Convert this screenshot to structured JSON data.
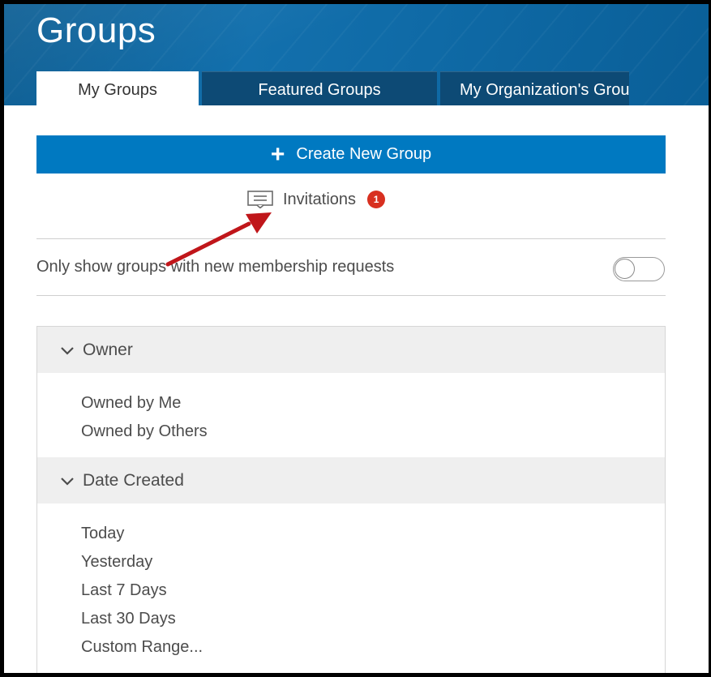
{
  "header": {
    "title": "Groups",
    "tabs": [
      {
        "label": "My Groups",
        "active": true
      },
      {
        "label": "Featured Groups",
        "active": false
      },
      {
        "label": "My Organization's Grou",
        "active": false
      }
    ]
  },
  "actions": {
    "create_label": "Create New Group",
    "invitations_label": "Invitations",
    "invitations_count": "1"
  },
  "filters": {
    "toggle_label": "Only show groups with new membership requests",
    "toggle_on": false,
    "sections": [
      {
        "title": "Owner",
        "items": [
          "Owned by Me",
          "Owned by Others"
        ]
      },
      {
        "title": "Date Created",
        "items": [
          "Today",
          "Yesterday",
          "Last 7 Days",
          "Last 30 Days",
          "Custom Range..."
        ]
      }
    ]
  },
  "colors": {
    "header_blue": "#0b5d93",
    "tab_dark": "#0d4a75",
    "button_blue": "#0079c1",
    "badge_red": "#d83020",
    "annotation_arrow": "#c0161a"
  }
}
